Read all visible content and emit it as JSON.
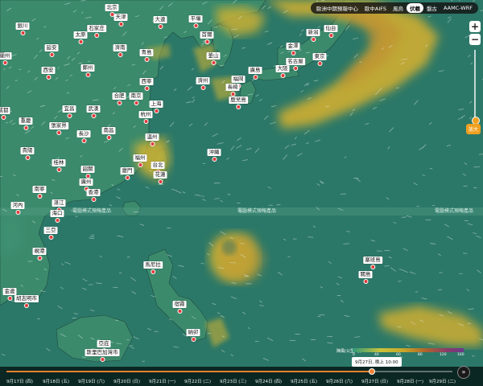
{
  "top_tabs": [
    {
      "label": "歐洲中期預報中心",
      "active": false
    },
    {
      "label": "歐中AIFS",
      "active": false
    },
    {
      "label": "風烏",
      "active": false
    },
    {
      "label": "伏羲",
      "active": true
    },
    {
      "label": "盤古",
      "active": false
    },
    {
      "label": "AAMC-WRF",
      "active": false
    }
  ],
  "zoom": {
    "plus": "+",
    "minus": "−",
    "label": "放大"
  },
  "watermarks": [
    "電腦模式預報產品",
    "電腦模式預報產品",
    "電腦模式預報產品"
  ],
  "cities": [
    {
      "name": "北京"
    },
    {
      "name": "天津"
    },
    {
      "name": "大連"
    },
    {
      "name": "平壤"
    },
    {
      "name": "首爾"
    },
    {
      "name": "呼和浩特"
    },
    {
      "name": "太原"
    },
    {
      "name": "石家庄"
    },
    {
      "name": "銀川"
    },
    {
      "name": "蘭州"
    },
    {
      "name": "延安"
    },
    {
      "name": "濟南"
    },
    {
      "name": "青島"
    },
    {
      "name": "西安"
    },
    {
      "name": "鄭州"
    },
    {
      "name": "西寧"
    },
    {
      "name": "合肥"
    },
    {
      "name": "南京"
    },
    {
      "name": "上海"
    },
    {
      "name": "宜昌"
    },
    {
      "name": "武漢"
    },
    {
      "name": "杭州"
    },
    {
      "name": "重慶"
    },
    {
      "name": "張家界"
    },
    {
      "name": "長沙"
    },
    {
      "name": "南昌"
    },
    {
      "name": "温州"
    },
    {
      "name": "成都"
    },
    {
      "name": "貴陽"
    },
    {
      "name": "福州"
    },
    {
      "name": "桂林"
    },
    {
      "name": "韶關"
    },
    {
      "name": "廈門"
    },
    {
      "name": "台北"
    },
    {
      "name": "花蓮"
    },
    {
      "name": "廣州"
    },
    {
      "name": "香港"
    },
    {
      "name": "南寧"
    },
    {
      "name": "湛江"
    },
    {
      "name": "海口"
    },
    {
      "name": "河內"
    },
    {
      "name": "三亞"
    },
    {
      "name": "峴港"
    },
    {
      "name": "胡志明市"
    },
    {
      "name": "金邊"
    },
    {
      "name": "釜山"
    },
    {
      "name": "濟州"
    },
    {
      "name": "福岡"
    },
    {
      "name": "長崎"
    },
    {
      "name": "鹿兒島"
    },
    {
      "name": "大阪"
    },
    {
      "name": "名古屋"
    },
    {
      "name": "東京"
    },
    {
      "name": "金澤"
    },
    {
      "name": "新潟"
    },
    {
      "name": "仙台"
    },
    {
      "name": "廣島"
    },
    {
      "name": "四國"
    },
    {
      "name": "沖繩"
    },
    {
      "name": "那霸"
    },
    {
      "name": "石垣島"
    },
    {
      "name": "宮古島"
    },
    {
      "name": "鹿兒島"
    },
    {
      "name": "馬尼拉"
    },
    {
      "name": "宿霧"
    },
    {
      "name": "納卯"
    },
    {
      "name": "亞庇"
    },
    {
      "name": "斯里巴加灣市"
    },
    {
      "name": "塞班島"
    },
    {
      "name": "關島"
    },
    {
      "name": "海參崴"
    }
  ],
  "legend": {
    "title": "陣風(公里/時)",
    "ticks": [
      "0",
      "40",
      "60",
      "80",
      "120",
      "160"
    ]
  },
  "tooltip": "9月27日, 晚上 10:00",
  "timeline": {
    "days": [
      "9月17日 (四)",
      "9月18日 (五)",
      "9月19日 (六)",
      "9月20日 (日)",
      "9月21日 (一)",
      "9月22日 (二)",
      "9月23日 (三)",
      "9月24日 (四)",
      "9月25日 (五)",
      "9月26日 (六)",
      "9月27日 (日)",
      "9月28日 (一)",
      "9月29日 (二)"
    ],
    "progress": 0.82,
    "play_icon": "»"
  },
  "colors": {
    "ocean": "#2d7a6a",
    "land": "#3a8a6a",
    "wind_yellow": "#d2b431",
    "wind_orange": "#c89a30",
    "accent": "#f08030"
  }
}
